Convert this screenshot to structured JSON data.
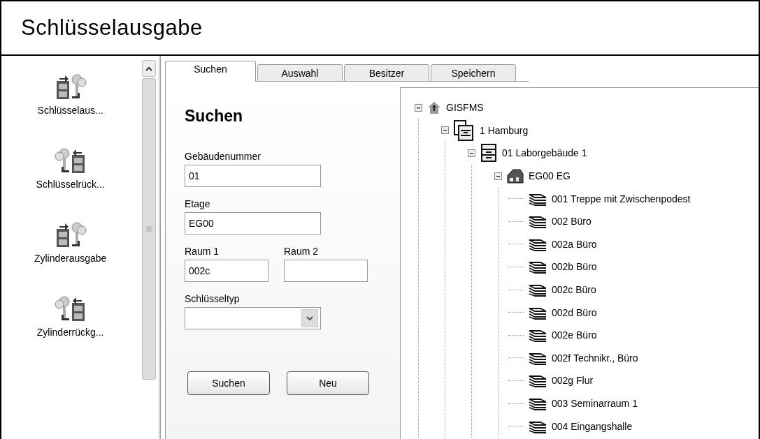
{
  "window": {
    "title": "Schlüsselausgabe"
  },
  "sidebar": {
    "items": [
      {
        "label": "Schlüsselaus...",
        "kind": "issue"
      },
      {
        "label": "Schlüsselrück...",
        "kind": "return"
      },
      {
        "label": "Zylinderausgabe",
        "kind": "issue"
      },
      {
        "label": "Zylinderrückg...",
        "kind": "return"
      }
    ]
  },
  "tabs": [
    {
      "label": "Suchen",
      "selected": true
    },
    {
      "label": "Auswahl",
      "selected": false
    },
    {
      "label": "Besitzer",
      "selected": false
    },
    {
      "label": "Speichern",
      "selected": false
    }
  ],
  "form": {
    "heading": "Suchen",
    "rows": [
      [
        {
          "label": "Gebäudenummer",
          "kind": "text",
          "value": "01"
        }
      ],
      [
        {
          "label": "Etage",
          "kind": "text",
          "value": "EG00"
        }
      ],
      [
        {
          "label": "Raum 1",
          "kind": "text",
          "value": "002c"
        },
        {
          "label": "Raum 2",
          "kind": "text"
        }
      ],
      [
        {
          "label": "Schlüsseltyp",
          "kind": "select"
        }
      ]
    ],
    "buttons": [
      "Suchen",
      "Neu"
    ]
  },
  "tree": [
    {
      "label": "GISFMS",
      "kind": "root",
      "expanded": true,
      "children": [
        {
          "label": "1 Hamburg",
          "kind": "site",
          "expanded": true,
          "children": [
            {
              "label": "01 Laborgebäude 1",
              "kind": "building",
              "expanded": true,
              "children": [
                {
                  "label": "EG00 EG",
                  "kind": "floor",
                  "expanded": true,
                  "children": [
                    {
                      "label": "001 Treppe mit Zwischenpodest",
                      "kind": "room"
                    },
                    {
                      "label": "002 Büro",
                      "kind": "room"
                    },
                    {
                      "label": "002a Büro",
                      "kind": "room"
                    },
                    {
                      "label": "002b Büro",
                      "kind": "room"
                    },
                    {
                      "label": "002c Büro",
                      "kind": "room"
                    },
                    {
                      "label": "002d Büro",
                      "kind": "room"
                    },
                    {
                      "label": "002e Büro",
                      "kind": "room"
                    },
                    {
                      "label": "002f Technikr., Büro",
                      "kind": "room"
                    },
                    {
                      "label": "002g Flur",
                      "kind": "room"
                    },
                    {
                      "label": "003 Seminarraum 1",
                      "kind": "room"
                    },
                    {
                      "label": "004 Eingangshalle",
                      "kind": "room"
                    }
                  ]
                }
              ]
            }
          ]
        }
      ]
    }
  ]
}
